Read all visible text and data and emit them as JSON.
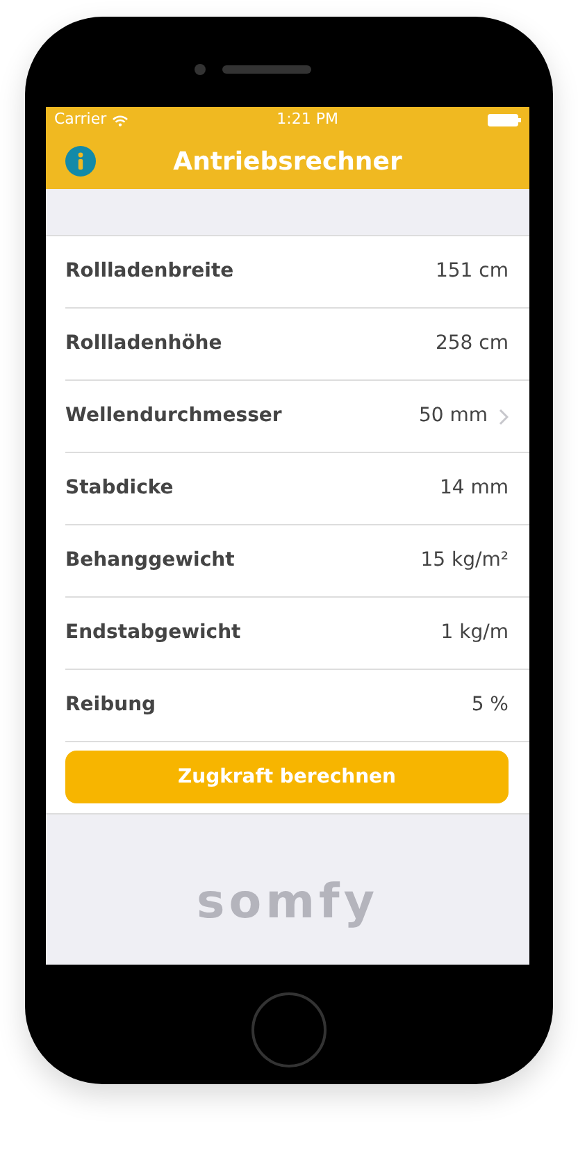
{
  "status_bar": {
    "carrier": "Carrier",
    "time": "1:21 PM"
  },
  "navbar": {
    "title": "Antriebsrechner"
  },
  "rows": [
    {
      "label": "Rollladenbreite",
      "value": "151 cm",
      "chevron": false
    },
    {
      "label": "Rollladenhöhe",
      "value": "258 cm",
      "chevron": false
    },
    {
      "label": "Wellendurchmesser",
      "value": "50 mm",
      "chevron": true
    },
    {
      "label": "Stabdicke",
      "value": "14 mm",
      "chevron": false
    },
    {
      "label": "Behanggewicht",
      "value": "15 kg/m²",
      "chevron": false
    },
    {
      "label": "Endstabgewicht",
      "value": "1 kg/m",
      "chevron": false
    },
    {
      "label": "Reibung",
      "value": "5 %",
      "chevron": false
    }
  ],
  "button": "Zugkraft berechnen",
  "logo": "somfy"
}
